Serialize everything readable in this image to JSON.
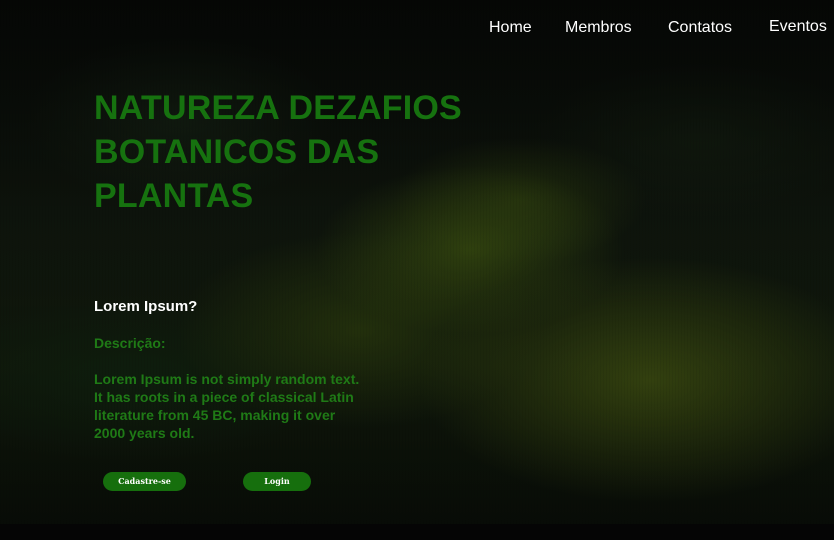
{
  "nav": {
    "items": [
      {
        "label": "Home"
      },
      {
        "label": "Membros"
      },
      {
        "label": "Contatos"
      },
      {
        "label": "Eventos"
      }
    ]
  },
  "hero": {
    "title_lines": [
      "NATUREZA DEZAFIOS",
      "BOTANICOS DAS",
      "PLANTAS"
    ],
    "question": "Lorem Ipsum?",
    "description_label": "Descrição:",
    "description_lines": [
      "Lorem Ipsum is not simply random text.",
      "It has roots in a piece of classical Latin",
      "literature from 45 BC, making it over",
      "2000 years old."
    ]
  },
  "buttons": {
    "signup_label": "Cadastre-se",
    "login_label": "Login"
  },
  "colors": {
    "accent_green": "#16720f",
    "text_green": "#1f7a16",
    "button_green": "#166f0d",
    "nav_text": "#ffffff"
  }
}
